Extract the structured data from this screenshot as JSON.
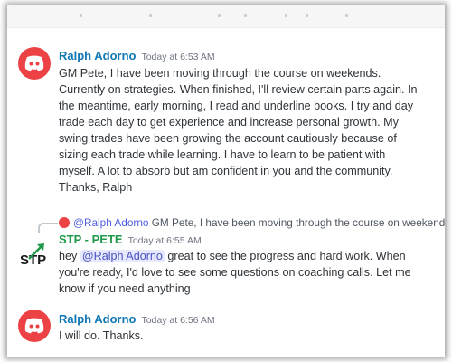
{
  "messages": [
    {
      "author": "Ralph Adorno",
      "timestamp": "Today at 6:53 AM",
      "avatar_icon": "discord-logo-icon",
      "text": "GM Pete,  I have been moving through the course on weekends.\nCurrently on strategies. When finished, I'll review certain parts again. In\nthe meantime, early morning, I read and underline books. I try and day\ntrade each day to get experience and increase personal growth. My\nswing trades have been growing the account cautiously  because of\nsizing each trade while learning. I have to learn to be patient with\nmyself. A lot to absorb but am confident in you and the community.\nThanks, Ralph"
    },
    {
      "reply": {
        "mention": "@Ralph Adorno",
        "snippet": "GM Pete, I have been moving through the course on weekends"
      },
      "author": "STP - PETE",
      "timestamp": "Today at 6:55 AM",
      "avatar_icon": "stp-logo-icon",
      "logo_text": "STP",
      "text_prefix": "hey ",
      "mention": "@Ralph Adorno",
      "text_rest": " great to see the progress and hard work. When\nyou're ready, I'd love to see some questions on coaching calls. Let me\nknow if you need anything"
    },
    {
      "author": "Ralph Adorno",
      "timestamp": "Today at 6:56 AM",
      "avatar_icon": "discord-logo-icon",
      "text": "I will do. Thanks."
    }
  ],
  "colors": {
    "author_ralph": "#0f77b5",
    "author_stp": "#1f9a4a",
    "discord_red": "#ed4245",
    "mention_bg": "#e6e8fd"
  }
}
